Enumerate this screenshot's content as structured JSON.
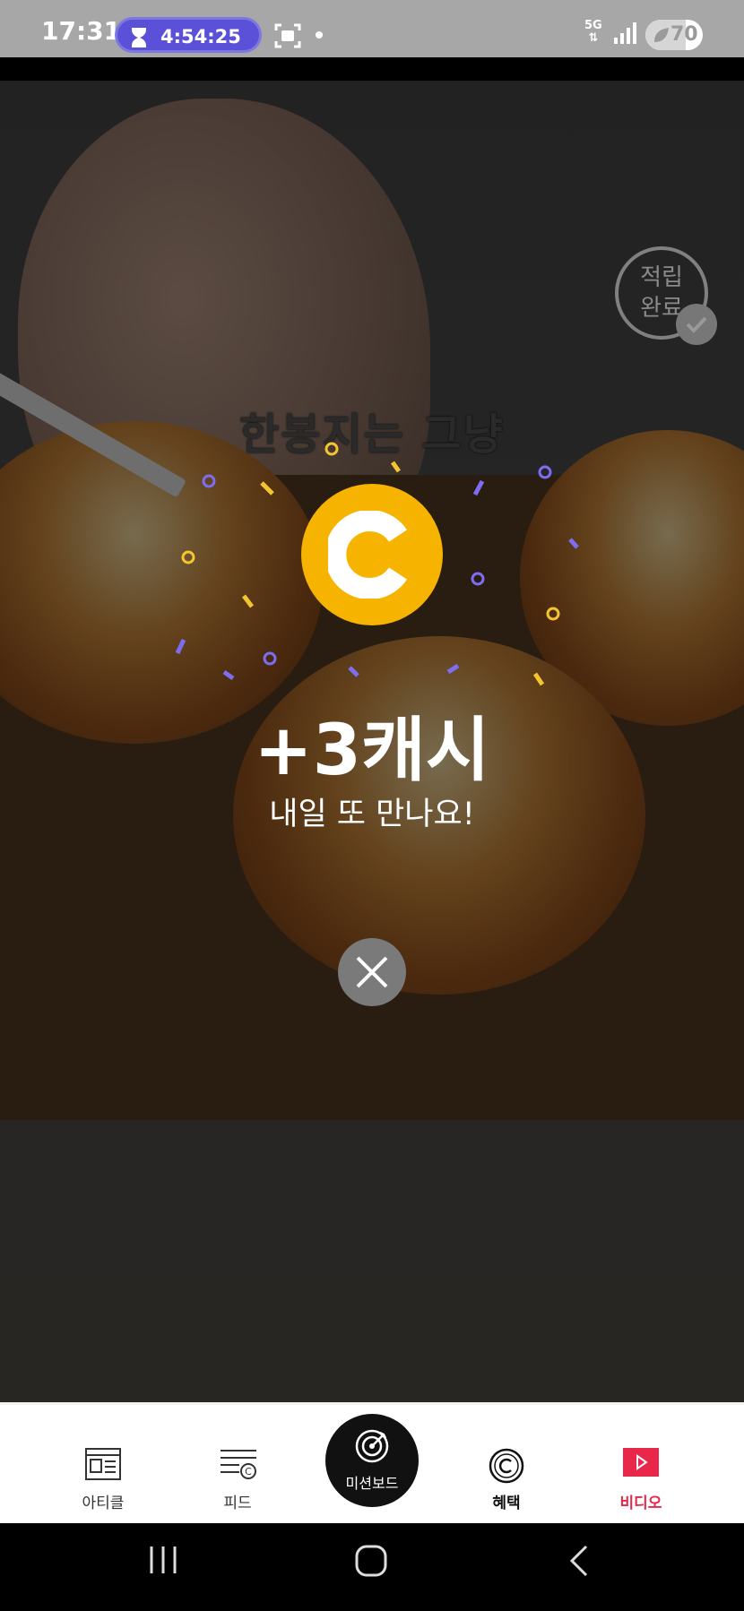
{
  "status_bar": {
    "time": "17:31",
    "timer": "4:54:25",
    "network": "5G",
    "battery_percent": "70",
    "battery_level": 0.7
  },
  "video": {
    "caption": "한봉지는 그냥",
    "stamp_text": [
      "적립",
      "완료"
    ]
  },
  "reward": {
    "coin_symbol": "C",
    "amount": "+3캐시",
    "message": "내일 또 만나요!"
  },
  "bottom_nav": {
    "items": [
      {
        "label": "아티클",
        "icon": "article-icon"
      },
      {
        "label": "피드",
        "icon": "feed-icon"
      },
      {
        "label": "미션보드",
        "icon": "target-icon"
      },
      {
        "label": "혜택",
        "icon": "cash-coin-icon"
      },
      {
        "label": "비디오",
        "icon": "play-icon"
      }
    ],
    "active_color": "#e8274b"
  },
  "colors": {
    "coin": "#f6b400",
    "timer_pill": "#5b51d8",
    "confetti_purple": "#7d6df0",
    "confetti_yellow": "#f5c431"
  }
}
